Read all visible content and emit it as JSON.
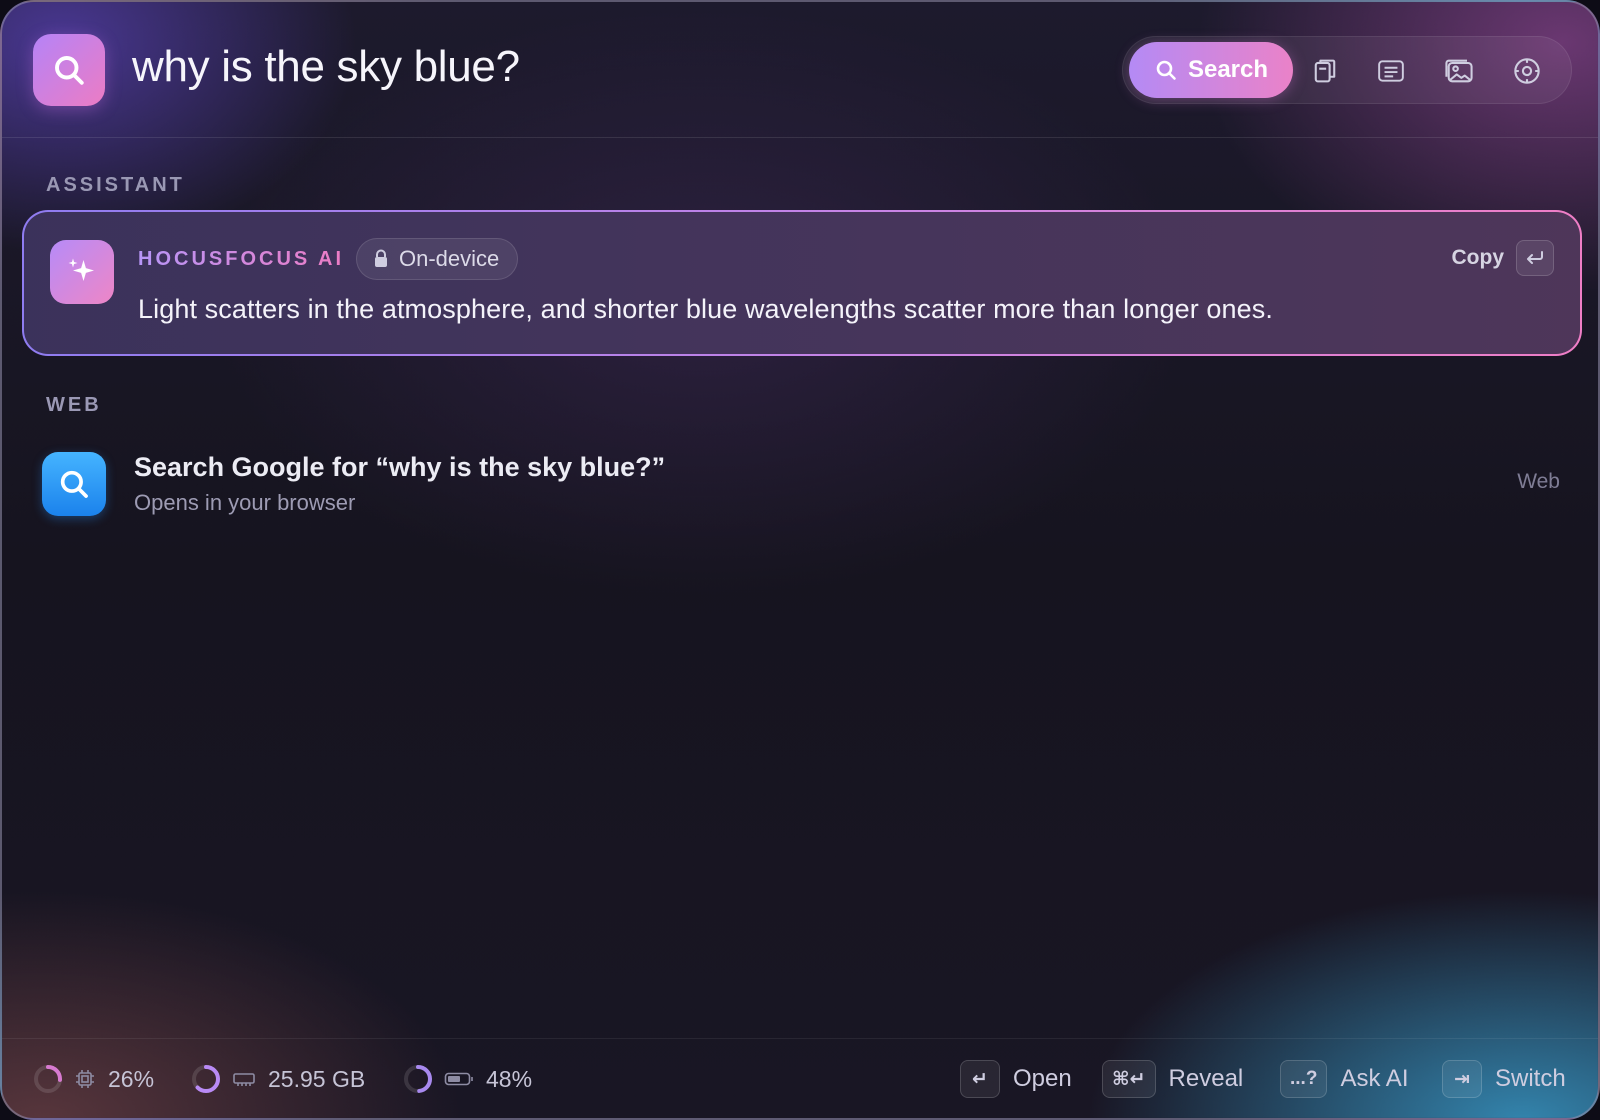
{
  "header": {
    "query": "why is the sky blue?",
    "toolbar": {
      "search_label": "Search",
      "tools": [
        "clipboard-icon",
        "notes-icon",
        "gallery-icon",
        "settings-icon"
      ]
    }
  },
  "sections": {
    "assistant": "ASSISTANT",
    "web": "WEB"
  },
  "assistant": {
    "name": "HOCUSFOCUS AI",
    "badge": "On-device",
    "answer": "Light scatters in the atmosphere, and shorter blue wavelengths scatter more than longer ones.",
    "copy_label": "Copy",
    "enter_key": "↵",
    "colors": {
      "gradient_start": "#b68bf8",
      "gradient_end": "#ee86c6"
    }
  },
  "web_result": {
    "title": "Search Google for “why is the sky blue?”",
    "subtitle": "Opens in your browser",
    "tag": "Web",
    "icon_color": "#2a93f5"
  },
  "footer": {
    "stats": [
      {
        "icon": "cpu-icon",
        "value": "26%",
        "fraction": 0.26,
        "ring_color": "#d77ad0"
      },
      {
        "icon": "memory-icon",
        "value": "25.95 GB",
        "fraction": 0.62,
        "ring_color": "#b98af5"
      },
      {
        "icon": "battery-icon",
        "value": "48%",
        "fraction": 0.48,
        "ring_color": "#a889ef"
      }
    ],
    "hints": [
      {
        "key": "↵",
        "label": "Open"
      },
      {
        "key": "⌘↵",
        "label": "Reveal"
      },
      {
        "key": "...?",
        "label": "Ask AI"
      },
      {
        "key": "⇥",
        "label": "Switch"
      }
    ]
  }
}
